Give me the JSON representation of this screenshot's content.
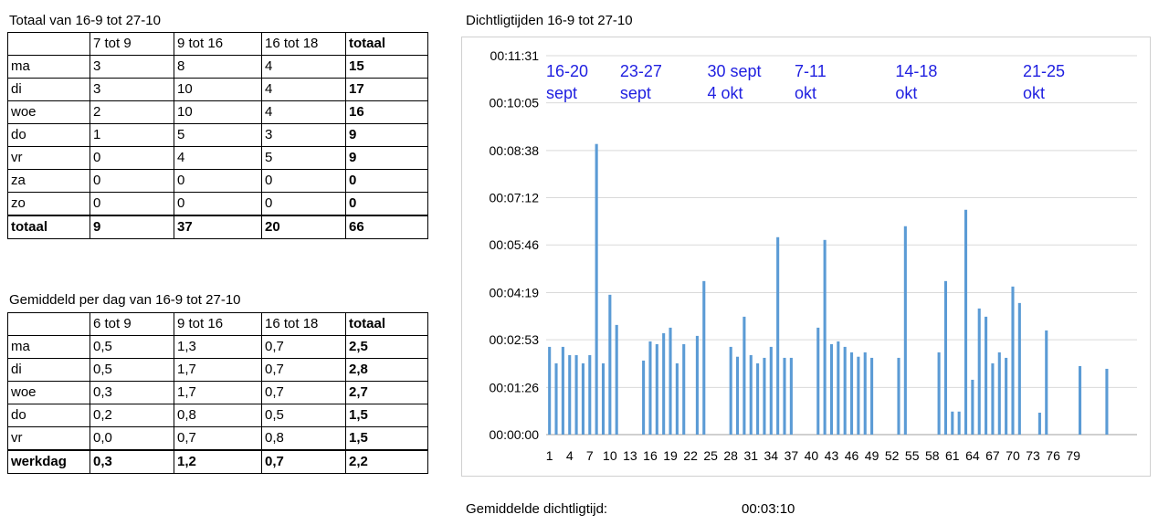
{
  "table1": {
    "title": "Totaal van 16-9 tot 27-10",
    "headers": [
      "",
      "7 tot 9",
      "9 tot 16",
      "16 tot 18",
      "totaal"
    ],
    "rows": [
      [
        "ma",
        "3",
        "8",
        "4",
        "15"
      ],
      [
        "di",
        "3",
        "10",
        "4",
        "17"
      ],
      [
        "woe",
        "2",
        "10",
        "4",
        "16"
      ],
      [
        "do",
        "1",
        "5",
        "3",
        "9"
      ],
      [
        "vr",
        "0",
        "4",
        "5",
        "9"
      ],
      [
        "za",
        "0",
        "0",
        "0",
        "0"
      ],
      [
        "zo",
        "0",
        "0",
        "0",
        "0"
      ]
    ],
    "total_row": [
      "totaal",
      "9",
      "37",
      "20",
      "66"
    ]
  },
  "table2": {
    "title": "Gemiddeld per dag van 16-9 tot 27-10",
    "headers": [
      "",
      "6 tot 9",
      "9 tot 16",
      "16 tot 18",
      "totaal"
    ],
    "rows": [
      [
        "ma",
        "0,5",
        "1,3",
        "0,7",
        "2,5"
      ],
      [
        "di",
        "0,5",
        "1,7",
        "0,7",
        "2,8"
      ],
      [
        "woe",
        "0,3",
        "1,7",
        "0,7",
        "2,7"
      ],
      [
        "do",
        "0,2",
        "0,8",
        "0,5",
        "1,5"
      ],
      [
        "vr",
        "0,0",
        "0,7",
        "0,8",
        "1,5"
      ]
    ],
    "total_row": [
      "werkdag",
      "0,3",
      "1,2",
      "0,7",
      "2,2"
    ]
  },
  "chart_title": "Dichtligtijden 16-9 tot 27-10",
  "chart_data": {
    "type": "bar",
    "title": "Dichtligtijden 16-9 tot 27-10",
    "xlabel": "",
    "ylabel": "",
    "y_unit": "seconds",
    "ylim": [
      0,
      691
    ],
    "yticks_seconds": [
      0,
      86,
      173,
      259,
      346,
      432,
      518,
      605,
      691
    ],
    "ytick_labels": [
      "00:00:00",
      "00:01:26",
      "00:02:53",
      "00:04:19",
      "00:05:46",
      "00:07:12",
      "00:08:38",
      "00:10:05",
      "00:11:31"
    ],
    "x": [
      1,
      2,
      3,
      4,
      5,
      6,
      7,
      8,
      9,
      10,
      11,
      12,
      13,
      14,
      15,
      16,
      17,
      18,
      19,
      20,
      21,
      22,
      23,
      24,
      25,
      26,
      27,
      28,
      29,
      30,
      31,
      32,
      33,
      34,
      35,
      36,
      37,
      38,
      39,
      40,
      41,
      42,
      43,
      44,
      45,
      46,
      47,
      48,
      49,
      50,
      51,
      52,
      53,
      54,
      55,
      56,
      57,
      58,
      59,
      60,
      61,
      62,
      63,
      64,
      65,
      66,
      67,
      68,
      69,
      70,
      71,
      72,
      73,
      74,
      75,
      76,
      77,
      78,
      79,
      80
    ],
    "xtick_labels": [
      "1",
      "4",
      "7",
      "10",
      "13",
      "16",
      "19",
      "22",
      "25",
      "28",
      "31",
      "34",
      "37",
      "40",
      "43",
      "46",
      "49",
      "52",
      "55",
      "58",
      "61",
      "64",
      "67",
      "70",
      "73",
      "76",
      "79"
    ],
    "values": [
      160,
      130,
      160,
      145,
      145,
      130,
      145,
      530,
      130,
      255,
      200,
      0,
      0,
      0,
      135,
      170,
      165,
      185,
      195,
      130,
      165,
      0,
      180,
      280,
      0,
      0,
      0,
      160,
      142,
      215,
      145,
      130,
      140,
      160,
      360,
      140,
      140,
      0,
      0,
      0,
      195,
      355,
      165,
      170,
      160,
      150,
      142,
      150,
      140,
      0,
      0,
      0,
      140,
      380,
      0,
      0,
      0,
      0,
      150,
      280,
      42,
      42,
      410,
      100,
      230,
      215,
      130,
      150,
      140,
      270,
      240,
      0,
      0,
      40,
      190,
      0,
      0,
      0,
      0,
      125,
      0,
      0,
      0,
      120,
      0,
      0,
      0,
      0
    ],
    "grid": true,
    "legend": "none",
    "annotations": [
      {
        "line1": "16-20",
        "line2": "sept",
        "at_x": 1
      },
      {
        "line1": "23-27",
        "line2": "sept",
        "at_x": 12
      },
      {
        "line1": "30 sept",
        "line2": "4 okt",
        "at_x": 25
      },
      {
        "line1": "7-11",
        "line2": "okt",
        "at_x": 38
      },
      {
        "line1": "14-18",
        "line2": "okt",
        "at_x": 53
      },
      {
        "line1": "21-25",
        "line2": "okt",
        "at_x": 72
      }
    ],
    "bar_color": "#5b9bd5",
    "annotation_color": "#1f1fe0",
    "grid_color": "#d9d9d9"
  },
  "footer": {
    "label": "Gemiddelde dichtligtijd:",
    "value": "00:03:10"
  }
}
